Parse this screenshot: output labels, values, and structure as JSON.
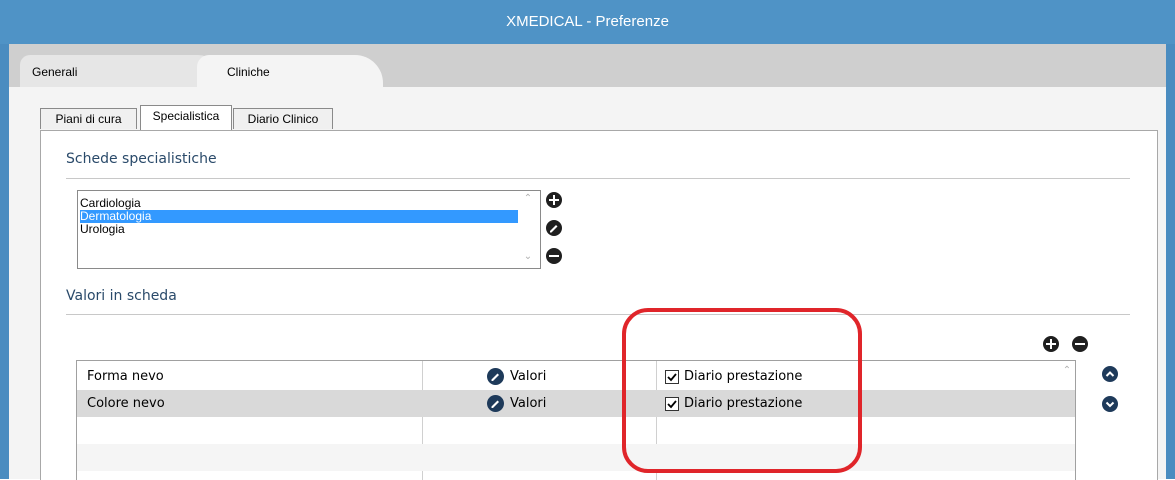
{
  "window": {
    "title": "XMEDICAL - Preferenze"
  },
  "main_tabs": [
    {
      "label": "Generali"
    },
    {
      "label": "Cliniche"
    }
  ],
  "sub_tabs": [
    {
      "label": "Piani di cura"
    },
    {
      "label": "Specialistica"
    },
    {
      "label": "Diario Clinico"
    }
  ],
  "schede": {
    "title": "Schede specialistiche",
    "items": [
      "Cardiologia",
      "Dermatologia",
      "Urologia"
    ],
    "selected": "Dermatologia"
  },
  "valori": {
    "title": "Valori in scheda",
    "rows": [
      {
        "name": "Forma nevo",
        "action": "Valori",
        "checkbox_label": "Diario prestazione",
        "checked": true
      },
      {
        "name": "Colore nevo",
        "action": "Valori",
        "checkbox_label": "Diario prestazione",
        "checked": true
      }
    ]
  },
  "colors": {
    "titlebar": "#4f93c6",
    "selection": "#3399ff",
    "highlight": "#e0252a"
  }
}
